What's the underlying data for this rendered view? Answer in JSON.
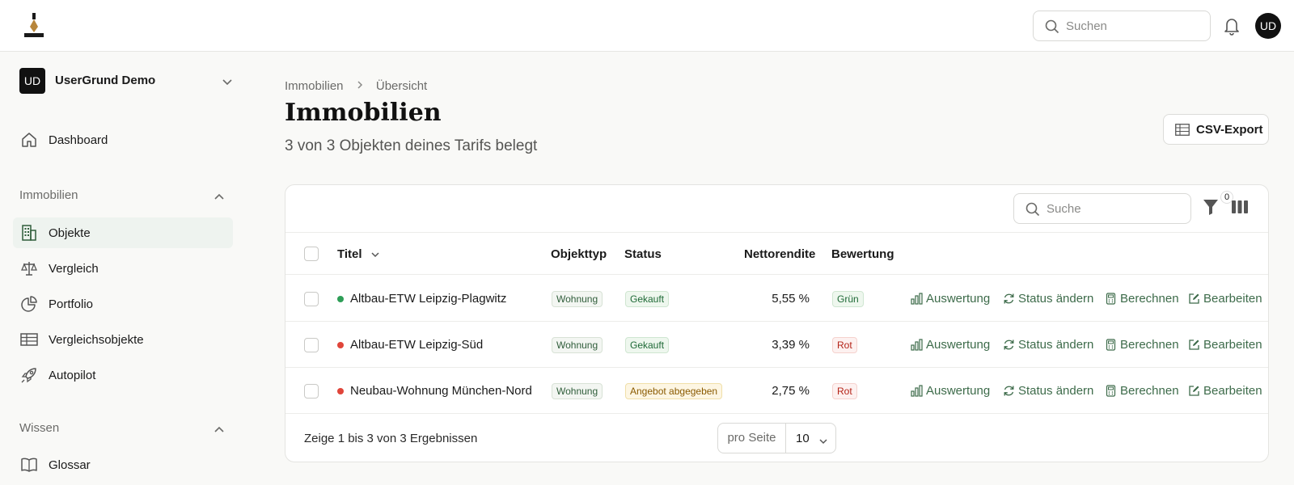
{
  "topbar": {
    "search_placeholder": "Suchen",
    "user_initials": "UD"
  },
  "sidebar": {
    "org": {
      "initials": "UD",
      "name": "UserGrund Demo"
    },
    "dashboard": "Dashboard",
    "section_immobilien": "Immobilien",
    "items": [
      {
        "label": "Objekte",
        "icon": "building-icon",
        "active": true
      },
      {
        "label": "Vergleich",
        "icon": "scale-icon"
      },
      {
        "label": "Portfolio",
        "icon": "pie-chart-icon"
      },
      {
        "label": "Vergleichsobjekte",
        "icon": "table-icon"
      },
      {
        "label": "Autopilot",
        "icon": "rocket-icon"
      }
    ],
    "section_wissen": "Wissen",
    "glossar": "Glossar"
  },
  "breadcrumb": {
    "root": "Immobilien",
    "current": "Übersicht"
  },
  "page": {
    "title": "Immobilien",
    "subtitle": "3 von 3 Objekten deines Tarifs belegt",
    "csv_export": "CSV-Export"
  },
  "table": {
    "search_placeholder": "Suche",
    "filter_count": "0",
    "columns": {
      "title": "Titel",
      "objekttyp": "Objekttyp",
      "status": "Status",
      "nettorendite": "Nettorendite",
      "bewertung": "Bewertung"
    },
    "actions": {
      "auswertung": "Auswertung",
      "status_aendern": "Status ändern",
      "berechnen": "Berechnen",
      "bearbeiten": "Bearbeiten"
    },
    "rows": [
      {
        "title": "Altbau-ETW Leipzig-Plagwitz",
        "dot_color": "#2e9e57",
        "objekttyp": "Wohnung",
        "status": "Gekauft",
        "nettorendite": "5,55 %",
        "bewertung": "Grün"
      },
      {
        "title": "Altbau-ETW Leipzig-Süd",
        "dot_color": "#e0453a",
        "objekttyp": "Wohnung",
        "status": "Gekauft",
        "nettorendite": "3,39 %",
        "bewertung": "Rot"
      },
      {
        "title": "Neubau-Wohnung München-Nord",
        "dot_color": "#e0453a",
        "objekttyp": "Wohnung",
        "status": "Angebot abgegeben",
        "nettorendite": "2,75 %",
        "bewertung": "Rot"
      }
    ],
    "footer": "Zeige 1 bis 3 von 3 Ergebnissen",
    "per_page_label": "pro Seite",
    "per_page_value": "10"
  },
  "colors": {
    "accent": "#3d6b4a",
    "active_bg": "#eef3ef",
    "dot_green": "#2e9e57",
    "dot_red": "#e0453a"
  }
}
